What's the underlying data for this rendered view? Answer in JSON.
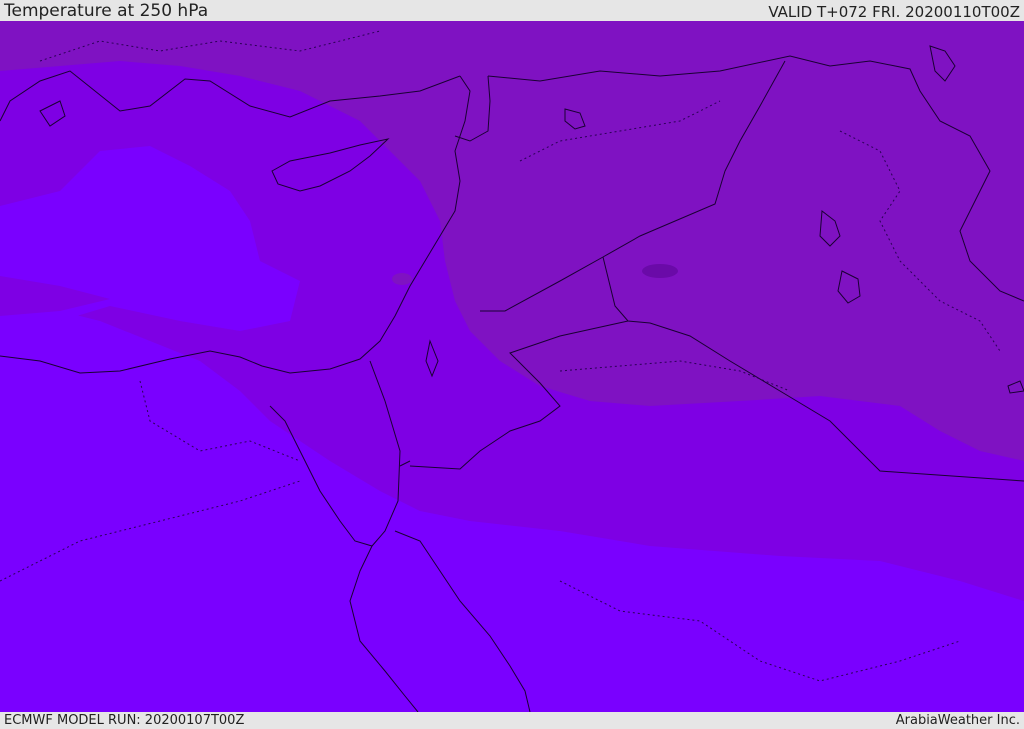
{
  "header": {
    "title": "Temperature at 250 hPa",
    "valid": "VALID T+072 FRI. 20200110T00Z"
  },
  "footer": {
    "model_run": "ECMWF MODEL RUN: 20200107T00Z",
    "credit": "ArabiaWeather Inc."
  },
  "colors": {
    "coldest": "#7a00ff",
    "cold": "#7e00e4",
    "cool": "#7f12c2",
    "warmest": "#6a0aa8",
    "borders": "#1a0033"
  },
  "icons": []
}
